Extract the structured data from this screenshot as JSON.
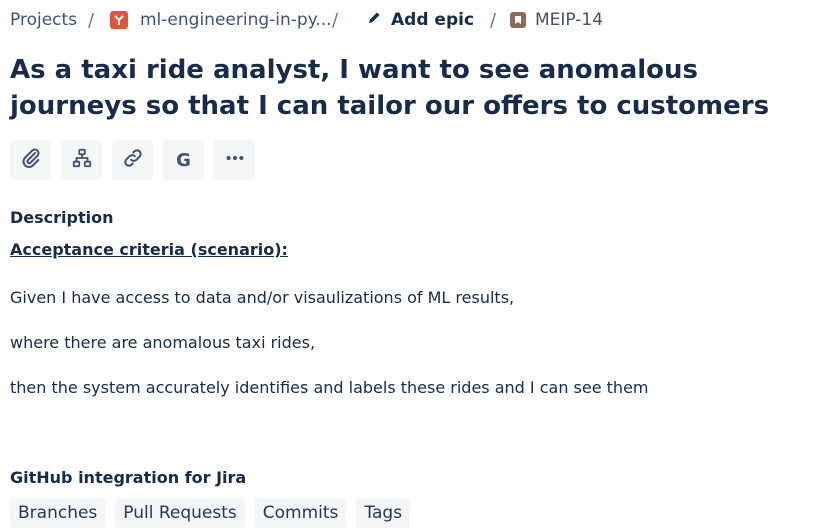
{
  "breadcrumb": {
    "projects": "Projects",
    "project_name": "ml-engineering-in-py...",
    "add_epic": "Add epic",
    "issue_key": "MEIP-14",
    "separator": "/"
  },
  "issue": {
    "title": "As a taxi ride analyst, I want to see anomalous journeys so that I can tailor our offers to customers"
  },
  "toolbar": {
    "items": [
      {
        "name": "attach",
        "icon": "paperclip-icon"
      },
      {
        "name": "child-issue",
        "icon": "hierarchy-icon"
      },
      {
        "name": "link-issue",
        "icon": "link-icon"
      },
      {
        "name": "github",
        "label": "G"
      },
      {
        "name": "more",
        "icon": "ellipsis-icon"
      }
    ]
  },
  "description": {
    "label": "Description",
    "heading": "Acceptance criteria (scenario):",
    "lines": [
      "Given I have access to data and/or visaulizations of ML results,",
      "where there are anomalous taxi rides,",
      "then the system accurately identifies and labels these rides and I can see them"
    ]
  },
  "github": {
    "label": "GitHub integration for Jira",
    "tabs": [
      "Branches",
      "Pull Requests",
      "Commits",
      "Tags"
    ]
  },
  "colors": {
    "text": "#172b4d",
    "muted": "#42526e",
    "button_bg": "#f4f5f7",
    "project_icon": "#e2543e",
    "issue_icon": "#8f6a5a"
  }
}
